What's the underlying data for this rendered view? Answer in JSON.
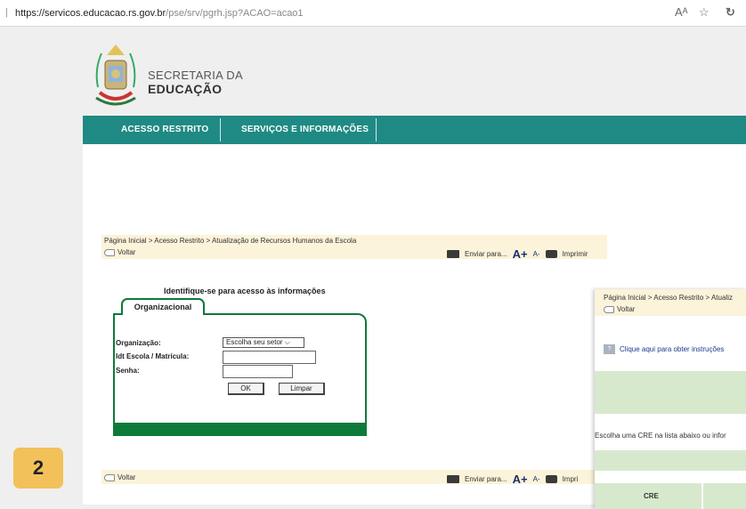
{
  "browser": {
    "url_host": "https://servicos.educacao.rs.gov.br",
    "url_path": "/pse/srv/pgrh.jsp?ACAO=acao1",
    "read_aloud_glyph": "Aᴬ",
    "favorite_glyph": "☆",
    "refresh_glyph": "↻"
  },
  "header": {
    "org_line1": "SECRETARIA DA",
    "org_line2": "EDUCAÇÃO"
  },
  "nav": {
    "items": [
      "ACESSO RESTRITO",
      "SERVIÇOS E INFORMAÇÕES"
    ]
  },
  "breadcrumb": "Página Inicial > Acesso Restrito > Atualização de Recursos Humanos da Escola",
  "toolbar": {
    "back_label": "Voltar",
    "send_label": "Enviar para...",
    "font_increase": "A+",
    "font_decrease": "A-",
    "print_label": "Imprimir",
    "print_label_bottom": "Impri"
  },
  "login": {
    "title": "Identifique-se para acesso às informações",
    "tab_label": "Organizacional",
    "org_label": "Organização:",
    "org_select_value": "Escolha seu setor",
    "id_label": "Idt Escola / Matrícula:",
    "password_label": "Senha:",
    "ok_label": "OK",
    "clear_label": "Limpar"
  },
  "step_badge": "2",
  "overlay": {
    "breadcrumb": "Página Inicial > Acesso Restrito > Atualiz",
    "back_label": "Voltar",
    "instructions_link": "Clique aqui para obter instruções",
    "choose_text": "Escolha uma CRE na lista abaixo ou infor",
    "table_header": "CRE",
    "help_glyph": "?"
  },
  "colors": {
    "nav_teal": "#1f8a84",
    "form_green": "#0e7a3a",
    "crumb_bg": "#fbf3da",
    "badge_yellow": "#f3c15a",
    "table_green": "#d7e9cd"
  }
}
